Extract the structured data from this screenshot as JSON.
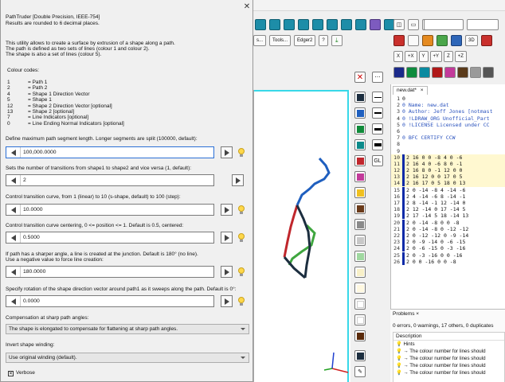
{
  "topbar": {
    "pin_glyph": "📌"
  },
  "toolbar": {
    "tools_label": "Tools...",
    "edger_label": "Edger2",
    "help_label": "?",
    "s_label": "s...",
    "x_btn": "X",
    "y_btn": "Y",
    "z_btn": "Z",
    "plus_y": "+Y",
    "plus_z": "+Z",
    "plus_x": "+X",
    "threed": "3D",
    "gl_label": "GL"
  },
  "dialog": {
    "title": "PathTruder [Double Precision, IEEE-754]",
    "subtitle": "Results are rounded to 6 decimal places.",
    "intro_1": "This utility allows to create a surface by extrusion of a shape along a path.",
    "intro_2": "The path is defined as two sets of lines (colour 1 and colour 2).",
    "intro_3": "The shape is also a set of lines (colour 5).",
    "colour_codes_label": "Colour codes:",
    "codes": [
      {
        "num": "1",
        "desc": "= Path 1"
      },
      {
        "num": "2",
        "desc": "= Path 2"
      },
      {
        "num": "4",
        "desc": "= Shape 1 Direction Vector"
      },
      {
        "num": "5",
        "desc": "= Shape 1"
      },
      {
        "num": "12",
        "desc": "= Shape 2 Direction Vector [optional]"
      },
      {
        "num": "13",
        "desc": "= Shape 2 [optional]"
      },
      {
        "num": "7",
        "desc": "= Line Indicators [optional]"
      },
      {
        "num": "0",
        "desc": "= Line Ending Normal Indicators [optional]"
      }
    ],
    "q_max_len": "Define maximum path segment length. Longer segments are split (100000, default):",
    "max_len_value": "100,000.0000",
    "q_transitions": "Sets the number of transitions from shape1 to shape2 and vice versa (1, default):",
    "transitions_value": "2",
    "q_curve": "Control transition curve, from 1 (linear) to 10 (s-shape, default) to 100 (step):",
    "curve_value": "10.0000",
    "q_centering": "Control transition curve centering, 0 <= position <= 1. Default is 0.5, centered:",
    "centering_value": "0.5000",
    "q_sharp_1": "If path has a sharper angle, a line is created at the junction. Default is 180° (no line).",
    "q_sharp_2": "Use a negative value to force line creation:",
    "sharp_value": "180.0000",
    "q_rotation": "Specify rotation of the shape direction vector around path1 as it sweeps along the path. Default is 0°:",
    "rotation_value": "0.0000",
    "comp_label": "Compensation at sharp path angles:",
    "comp_value": "The shape is elongated to compensate for flattening at sharp path angles.",
    "invert_label": "Invert shape winding:",
    "invert_value": "Use original winding (default).",
    "verbose_label": "Verbose"
  },
  "editor": {
    "tab_label": "new.dat*",
    "tab_close": "×",
    "lines": [
      {
        "n": "1",
        "text": "0"
      },
      {
        "n": "2",
        "text": "0 Name: new.dat"
      },
      {
        "n": "3",
        "text": "0 Author: Jeff Jones [notmast"
      },
      {
        "n": "4",
        "text": "0 !LDRAW_ORG Unofficial_Part"
      },
      {
        "n": "5",
        "text": "0 !LICENSE Licensed under CC"
      },
      {
        "n": "6",
        "text": ""
      },
      {
        "n": "7",
        "text": "0 BFC CERTIFY CCW"
      },
      {
        "n": "8",
        "text": ""
      },
      {
        "n": "9",
        "text": ""
      },
      {
        "n": "10",
        "text": "2 16 0 0 -8 4 0 -6"
      },
      {
        "n": "11",
        "text": "2 16 4 0 -6 8 0 -1"
      },
      {
        "n": "12",
        "text": "2 16 8 0 -1 12 0 0"
      },
      {
        "n": "13",
        "text": "2 16 12 0 0 17 0 5"
      },
      {
        "n": "14",
        "text": "2 16 17 0 5 18 0 13"
      },
      {
        "n": "15",
        "text": "2 0 -14 -8 4 -14 -6"
      },
      {
        "n": "16",
        "text": "2 4 -14 -6 8 -14 -1"
      },
      {
        "n": "17",
        "text": "2 8 -14 -1 12 -14 0"
      },
      {
        "n": "18",
        "text": "2 12 -14 0 17 -14 5"
      },
      {
        "n": "19",
        "text": "2 17 -14 5 18 -14 13"
      },
      {
        "n": "20",
        "text": "2 0 -14 -8 0 0 -8"
      },
      {
        "n": "21",
        "text": "2 0 -14 -8 0 -12 -12"
      },
      {
        "n": "22",
        "text": "2 0 -12 -12 0 -9 -14"
      },
      {
        "n": "23",
        "text": "2 0 -9 -14 0 -6 -15"
      },
      {
        "n": "24",
        "text": "2 0 -6 -15 0 -3 -16"
      },
      {
        "n": "25",
        "text": "2 0 -3 -16 0 0 -16"
      },
      {
        "n": "26",
        "text": "2 0 0 -16 0 0 -8"
      }
    ]
  },
  "problems": {
    "tab_label": "Problems",
    "tab_close": "×",
    "summary": "0 errors, 0 warnings, 17 others, 0 duplicates",
    "col_description": "Description",
    "hints_label": "Hints",
    "hint_text": "→ The colour number for lines should"
  },
  "colors": {
    "path_red": "#c0262c",
    "path_blue": "#1f5fbf",
    "shape_green": "#3fa63f",
    "shape_dark": "#1c2e3f",
    "frame_cyan": "#38d8e8",
    "badge_green": "#2d8a2d"
  }
}
